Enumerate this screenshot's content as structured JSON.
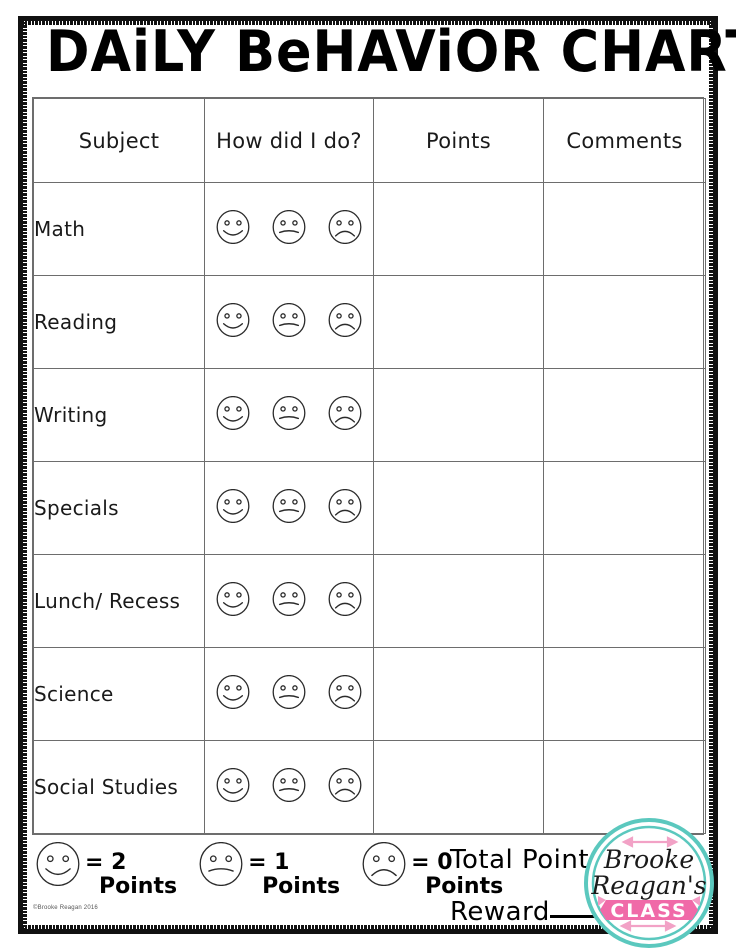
{
  "document": {
    "title": "DAiLY BeHAViOR CHART",
    "copyright": "©Brooke Reagan 2016"
  },
  "table": {
    "headers": [
      "Subject",
      "How did I do?",
      "Points",
      "Comments"
    ],
    "rows": [
      {
        "subject": "Math",
        "faces": [
          "happy",
          "neutral",
          "sad"
        ],
        "points": "",
        "comments": ""
      },
      {
        "subject": "Reading",
        "faces": [
          "happy",
          "neutral",
          "sad"
        ],
        "points": "",
        "comments": ""
      },
      {
        "subject": "Writing",
        "faces": [
          "happy",
          "neutral",
          "sad"
        ],
        "points": "",
        "comments": ""
      },
      {
        "subject": "Specials",
        "faces": [
          "happy",
          "neutral",
          "sad"
        ],
        "points": "",
        "comments": ""
      },
      {
        "subject": "Lunch/ Recess",
        "faces": [
          "happy",
          "neutral",
          "sad"
        ],
        "points": "",
        "comments": ""
      },
      {
        "subject": "Science",
        "faces": [
          "happy",
          "neutral",
          "sad"
        ],
        "points": "",
        "comments": ""
      },
      {
        "subject": "Social Studies",
        "faces": [
          "happy",
          "neutral",
          "sad"
        ],
        "points": "",
        "comments": ""
      }
    ]
  },
  "legend": {
    "items": [
      {
        "face": "happy-face-icon",
        "equals": "= 2",
        "unit": "Points"
      },
      {
        "face": "neutral-face-icon",
        "equals": "= 1",
        "unit": "Points"
      },
      {
        "face": "sad-face-icon",
        "equals": "= 0",
        "unit": "Points"
      }
    ]
  },
  "totals": {
    "total_points_label": "Total Points",
    "reward_label": "Reward"
  },
  "logo": {
    "line1": "Brooke",
    "line2": "Reagan's",
    "banner": "CLASS",
    "ring_color": "#5BC8BE",
    "banner_color": "#F06AA8",
    "arrow_color": "#F2A2C6",
    "script_color": "#1a1a1a"
  }
}
